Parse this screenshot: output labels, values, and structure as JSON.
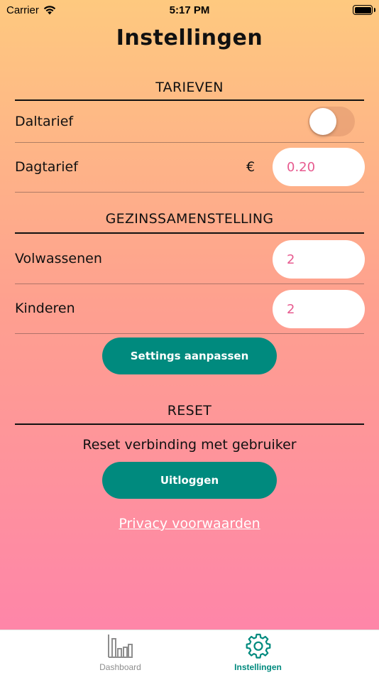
{
  "status_bar": {
    "carrier": "Carrier",
    "time": "5:17 PM"
  },
  "page": {
    "title": "Instellingen"
  },
  "tarieven": {
    "header": "TARIEVEN",
    "daltarief_label": "Daltarief",
    "daltarief_on": false,
    "dagtarief_label": "Dagtarief",
    "currency_symbol": "€",
    "dagtarief_value": "0.20"
  },
  "gezin": {
    "header": "GEZINSSAMENSTELLING",
    "volwassenen_label": "Volwassenen",
    "volwassenen_value": "2",
    "kinderen_label": "Kinderen",
    "kinderen_value": "2",
    "save_button": "Settings aanpassen"
  },
  "reset": {
    "header": "RESET",
    "description": "Reset verbinding met gebruiker",
    "logout_button": "Uitloggen",
    "privacy_link": "Privacy voorwaarden"
  },
  "tabs": [
    {
      "label": "Dashboard",
      "icon": "bar-chart-icon",
      "active": false
    },
    {
      "label": "Instellingen",
      "icon": "gear-icon",
      "active": true
    }
  ],
  "colors": {
    "accent": "#008a7e",
    "input_text": "#e75a8f",
    "gradient_top": "#fec97f",
    "gradient_bottom": "#fe82ac"
  }
}
